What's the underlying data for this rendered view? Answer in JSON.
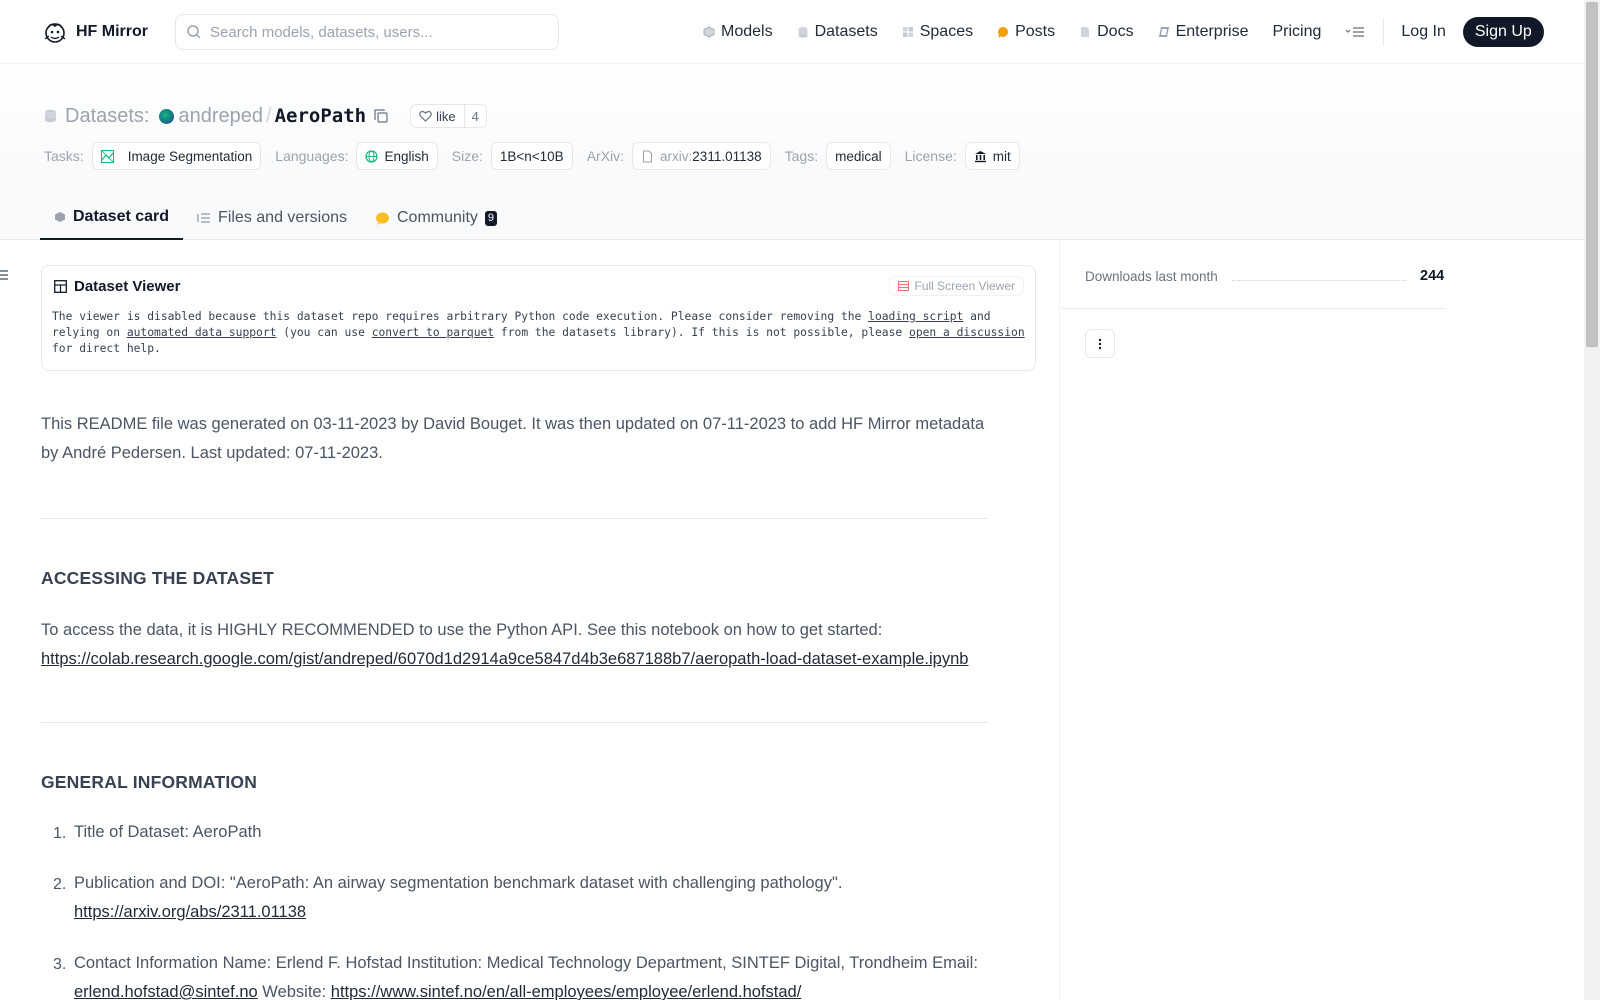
{
  "header": {
    "brand": "HF Mirror",
    "search_placeholder": "Search models, datasets, users...",
    "nav": [
      "Models",
      "Datasets",
      "Spaces",
      "Posts",
      "Docs",
      "Enterprise",
      "Pricing"
    ],
    "login": "Log In",
    "signup": "Sign Up"
  },
  "dataset": {
    "section_label": "Datasets:",
    "owner": "andreped",
    "slash": "/",
    "name": "AeroPath",
    "like_label": "like",
    "like_count": "4"
  },
  "tags": {
    "tasks_label": "Tasks:",
    "task": "Image Segmentation",
    "languages_label": "Languages:",
    "language": "English",
    "size_label": "Size:",
    "size": "1B<n<10B",
    "arxiv_label": "ArXiv:",
    "arxiv_prefix": "arxiv:",
    "arxiv_id": "2311.01138",
    "tags_label": "Tags:",
    "tag": "medical",
    "license_label": "License:",
    "license": "mit"
  },
  "tabs": {
    "card": "Dataset card",
    "files": "Files and versions",
    "community": "Community",
    "community_count": "9"
  },
  "viewer": {
    "title": "Dataset Viewer",
    "fullscreen": "Full Screen Viewer",
    "t1": "The viewer is disabled because this dataset repo requires arbitrary Python code execution. Please consider removing the ",
    "l1": "loading script",
    "t2": " and relying on ",
    "l2": "automated data support",
    "t3": " (you can use ",
    "l3": "convert to parquet",
    "t4": " from the datasets library). If this is not possible, please ",
    "l4": "open a discussion",
    "t5": " for direct help."
  },
  "content": {
    "intro": "This README file was generated on 03-11-2023 by David Bouget. It was then updated on 07-11-2023 to add HF Mirror metadata by André Pedersen. Last updated: 07-11-2023.",
    "h_access": "ACCESSING THE DATASET",
    "access_text": "To access the data, it is HIGHLY RECOMMENDED to use the Python API. See this notebook on how to get started:",
    "access_link": "https://colab.research.google.com/gist/andreped/6070d1d2914a9ce5847d4b3e687188b7/aeropath-load-dataset-example.ipynb",
    "h_general": "GENERAL INFORMATION",
    "items": [
      {
        "num": "1.",
        "text": "Title of Dataset: AeroPath"
      },
      {
        "num": "2.",
        "text": "Publication and DOI: \"AeroPath: An airway segmentation benchmark dataset with challenging pathology\".",
        "link": "https://arxiv.org/abs/2311.01138"
      },
      {
        "num": "3.",
        "text": "Contact Information Name: Erlend F. Hofstad Institution: Medical Technology Department, SINTEF Digital, Trondheim Email:",
        "email": "erlend.hofstad@sintef.no",
        "website_label": "Website:",
        "website": "https://www.sintef.no/en/all-employees/employee/erlend.hofstad/"
      }
    ]
  },
  "sidebar": {
    "downloads_label": "Downloads last month",
    "downloads_value": "244"
  }
}
